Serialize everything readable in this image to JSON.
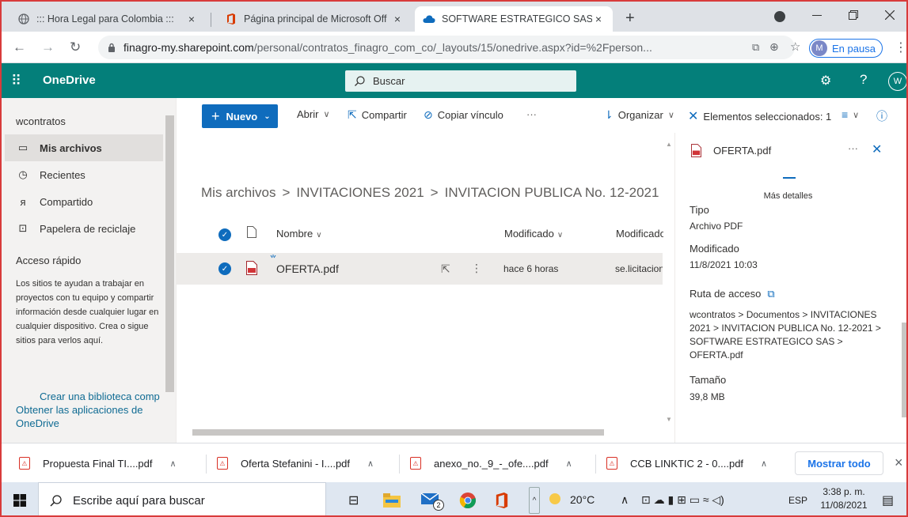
{
  "browser": {
    "tabs": [
      {
        "title": "::: Hora Legal para Colombia :::",
        "close": "×"
      },
      {
        "title": "Página principal de Microsoft Off",
        "close": "×"
      },
      {
        "title": "SOFTWARE ESTRATEGICO SAS - C",
        "close": "×"
      }
    ],
    "new_tab": "+",
    "url_host": "finagro-my.sharepoint.com",
    "url_path": "/personal/contratos_finagro_com_co/_layouts/15/onedrive.aspx?id=%2Fperson...",
    "profile_initial": "M",
    "profile_status": "En pausa"
  },
  "header": {
    "app_title": "OneDrive",
    "search_placeholder": "Buscar",
    "help": "?",
    "avatar": "W"
  },
  "left_nav": {
    "user": "wcontratos",
    "items": [
      {
        "label": "Mis archivos",
        "icon": "folder-icon"
      },
      {
        "label": "Recientes",
        "icon": "clock-icon"
      },
      {
        "label": "Compartido",
        "icon": "people-icon"
      },
      {
        "label": "Papelera de reciclaje",
        "icon": "trash-icon"
      }
    ],
    "quick_access_title": "Acceso rápido",
    "quick_access_text": "Los sitios te ayudan a trabajar en proyectos con tu equipo y compartir información desde cualquier lugar en cualquier dispositivo. Crea o sigue sitios para verlos aquí.",
    "create_library": "Crear una biblioteca comp",
    "get_apps": "Obtener las aplicaciones de OneDrive"
  },
  "command_bar": {
    "new_label": "Nuevo",
    "open_label": "Abrir",
    "share_label": "Compartir",
    "copy_link_label": "Copiar vínculo",
    "more": "···",
    "sort_label": "Organizar",
    "selected_label": "Elementos seleccionados: 1"
  },
  "breadcrumb": [
    "Mis archivos",
    "INVITACIONES 2021",
    "INVITACION PUBLICA No. 12-2021"
  ],
  "breadcrumb_sep": ">",
  "file_list": {
    "columns": {
      "name": "Nombre",
      "modified": "Modificado",
      "modified_by": "Modificado"
    },
    "rows": [
      {
        "name": "OFERTA.pdf",
        "modified": "hace 6 horas",
        "modified_by": "se.licitacion",
        "selected": true
      }
    ]
  },
  "details": {
    "file_name": "OFERTA.pdf",
    "more": "···",
    "more_details": "Más detalles",
    "type_label": "Tipo",
    "type_value": "Archivo PDF",
    "modified_label": "Modificado",
    "modified_value": "11/8/2021 10:03",
    "path_label": "Ruta de acceso",
    "path_value": "wcontratos > Documentos > INVITACIONES 2021 > INVITACION PUBLICA No. 12-2021 > SOFTWARE ESTRATEGICO SAS > OFERTA.pdf",
    "size_label": "Tamaño",
    "size_value": "39,8 MB"
  },
  "downloads": {
    "items": [
      "Propuesta Final TI....pdf",
      "Oferta Stefanini - I....pdf",
      "anexo_no._9_-_ofe....pdf",
      "CCB LINKTIC 2 - 0....pdf"
    ],
    "show_all": "Mostrar todo",
    "close": "×"
  },
  "taskbar": {
    "search_placeholder": "Escribe aquí para buscar",
    "mail_badge": "2",
    "temperature": "20°C",
    "language": "ESP",
    "time": "3:38 p. m.",
    "date": "11/08/2021"
  },
  "colors": {
    "onedrive_header": "#047f7a",
    "accent": "#0f6cbd",
    "tab_strip": "#dee1e6"
  }
}
